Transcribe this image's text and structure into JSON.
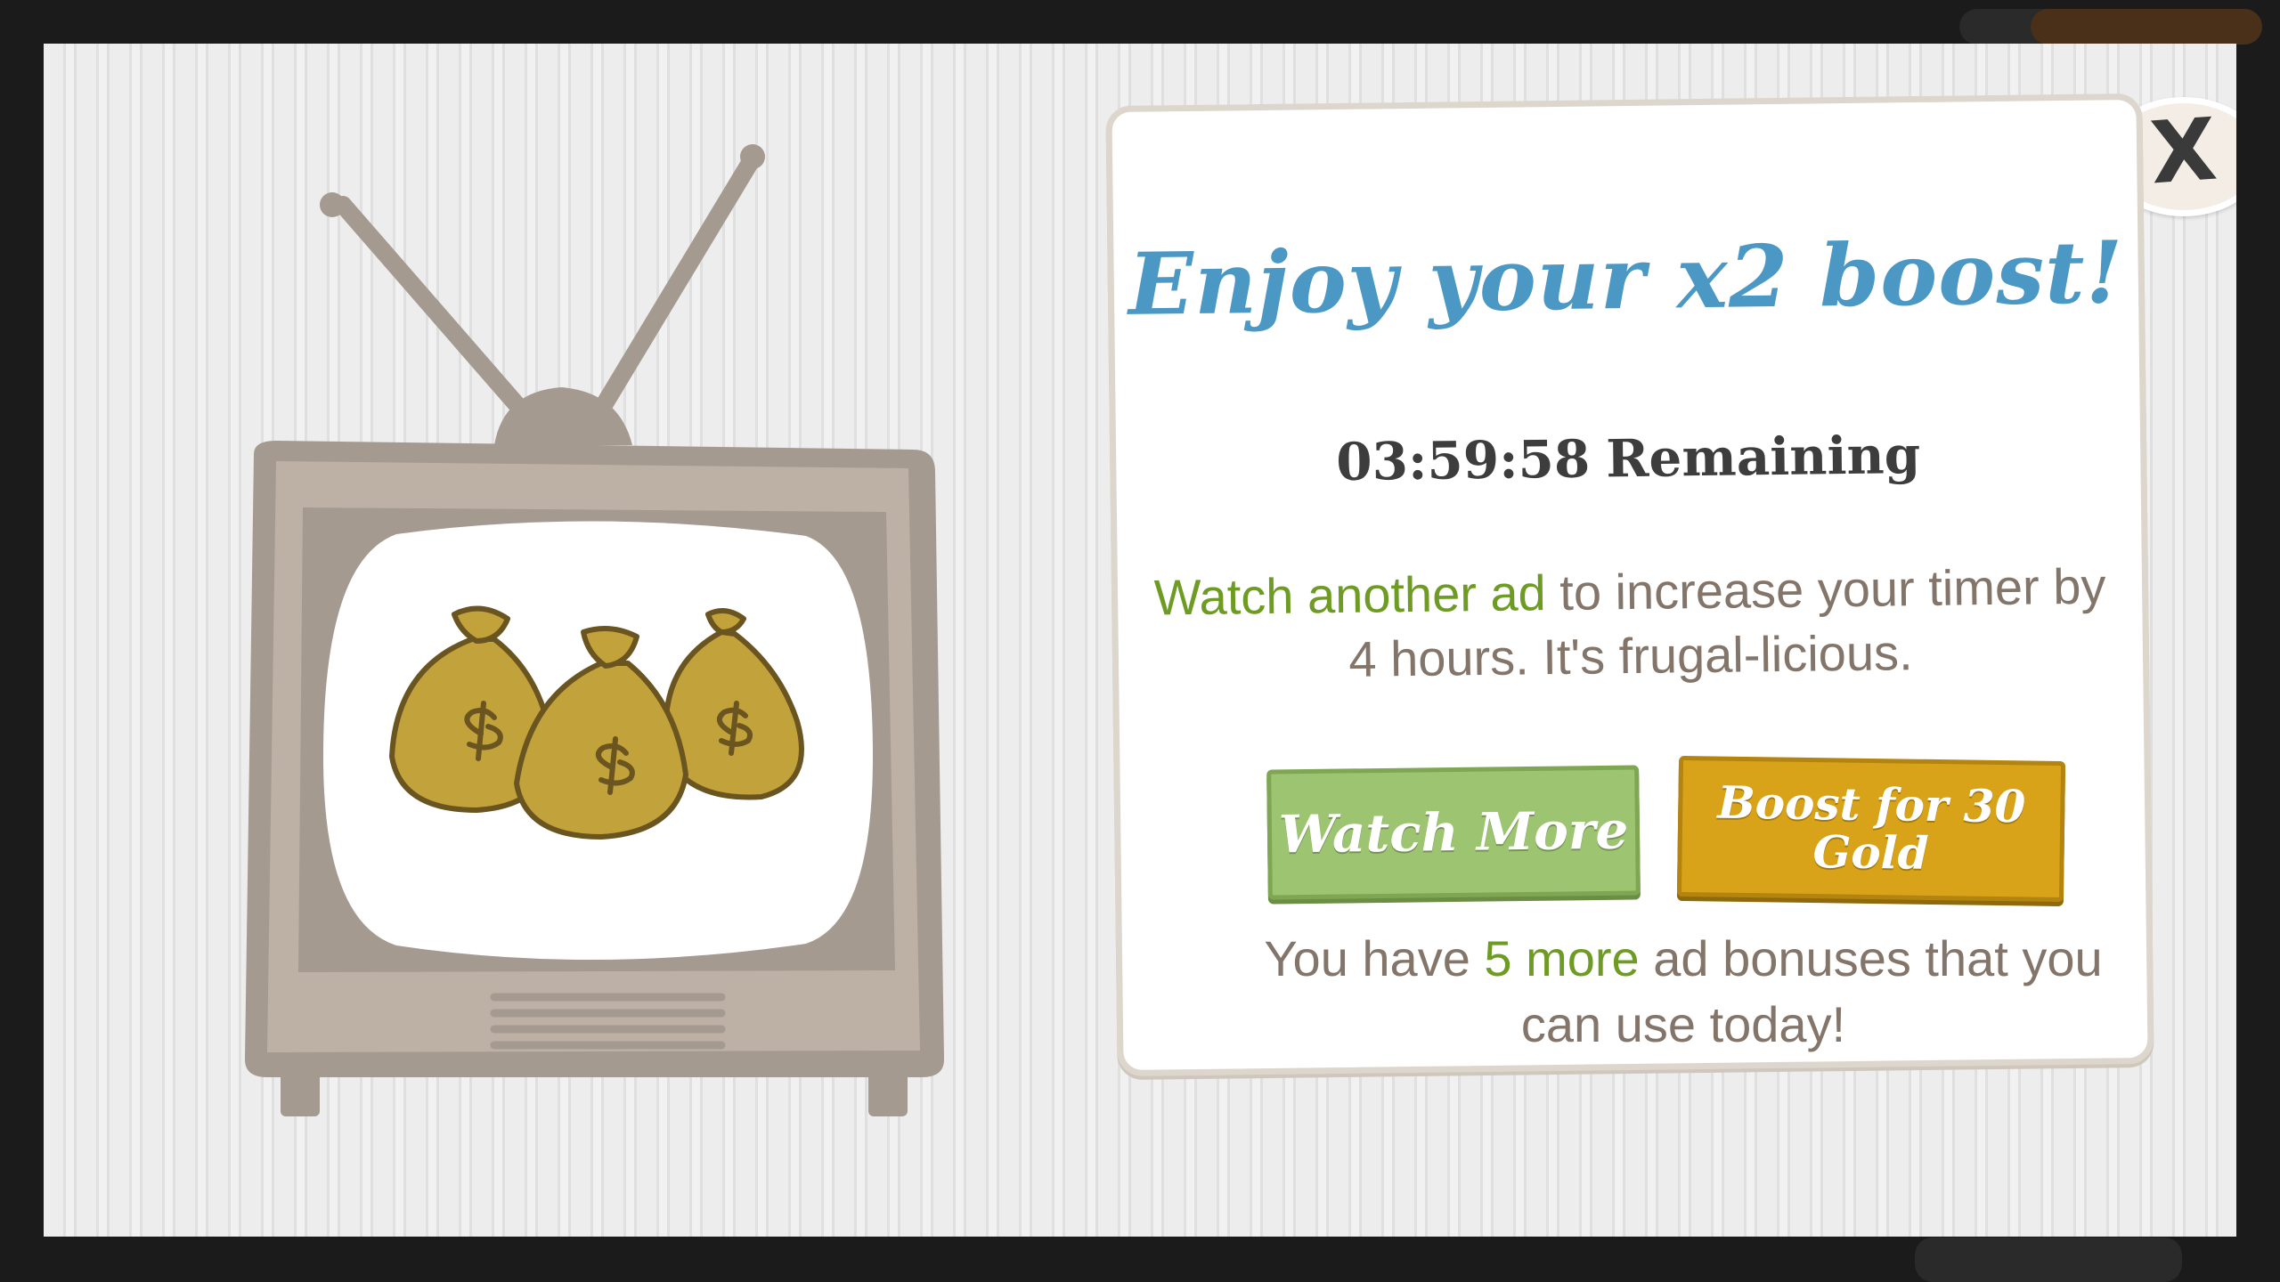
{
  "modal": {
    "close_label": "X",
    "title": "Enjoy your x2 boost!",
    "timer": {
      "value": "03:59:58",
      "suffix": "Remaining"
    },
    "description": {
      "highlight": "Watch another ad",
      "rest": "to increase your timer by 4 hours. It's frugal-licious."
    },
    "watch_button_label": "Watch More",
    "boost_button_label": "Boost for 30 Gold",
    "bonus": {
      "prefix": "You have",
      "highlight": "5 more",
      "rest": "ad bonuses that you can use today!"
    }
  },
  "colors": {
    "title_blue": "#4b98c4",
    "highlight_green": "#6e9b23",
    "watch_button": "#9dc470",
    "boost_button": "#d8a318",
    "body_text": "#837569"
  },
  "icons": {
    "tv": "retro-tv-icon",
    "money_bags": "money-bag-icon"
  }
}
